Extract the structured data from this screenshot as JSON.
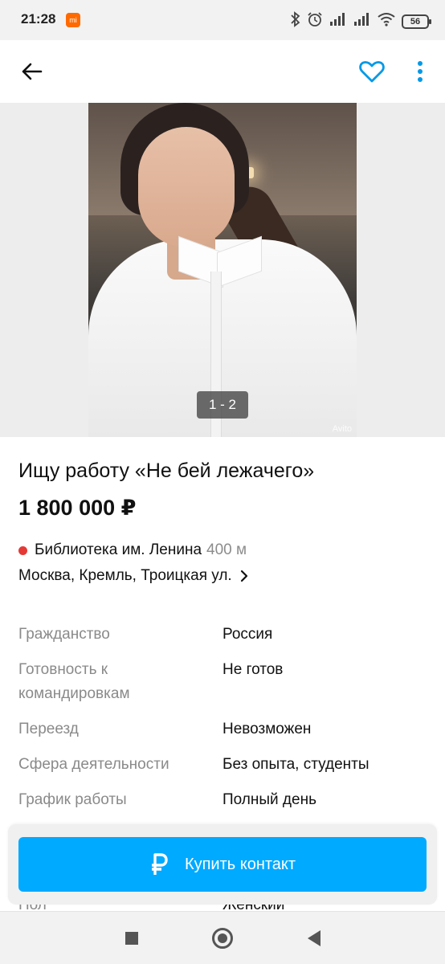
{
  "status_bar": {
    "time": "21:28",
    "battery": "56",
    "icons": [
      "app-notification-icon",
      "bluetooth-icon",
      "alarm-icon",
      "signal-icon",
      "signal-icon",
      "wifi-icon",
      "battery-icon"
    ]
  },
  "app_bar": {
    "back_icon": "arrow-left-icon",
    "favorite_icon": "heart-outline-icon",
    "more_icon": "more-vertical-icon",
    "accent_color": "#0099e6"
  },
  "gallery": {
    "counter": "1 - 2",
    "watermark": "Avito"
  },
  "listing": {
    "title": "Ищу работу «Не бей лежачего»",
    "price": "1 800 000 ₽",
    "metro": {
      "station": "Библиотека им. Ленина",
      "distance": "400 м",
      "line_color": "#e53935"
    },
    "address": "Москва, Кремль, Троицкая ул."
  },
  "params": [
    {
      "key": "Гражданство",
      "value": "Россия"
    },
    {
      "key": "Готовность к командировкам",
      "value": "Не готов"
    },
    {
      "key": "Переезд",
      "value": "Невозможен"
    },
    {
      "key": "Сфера деятельности",
      "value": "Без опыта, студенты"
    },
    {
      "key": "График работы",
      "value": "Полный день"
    }
  ],
  "peek_param": {
    "key": "Пол",
    "value": "Женский"
  },
  "action": {
    "label": "Купить контакт",
    "icon": "ruble-icon",
    "color": "#00aaff"
  },
  "nav_bar": {
    "recents_icon": "square-icon",
    "home_icon": "circle-icon",
    "back_icon": "triangle-back-icon"
  }
}
